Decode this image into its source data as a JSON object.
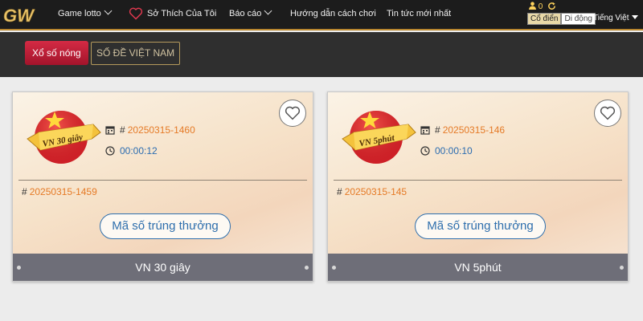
{
  "nav": {
    "logo_text": "GW",
    "items": [
      "Game lotto",
      "Sở Thích Của Tôi",
      "Báo cáo",
      "Hướng dẫn cách chơi",
      "Tin tức mới nhất"
    ],
    "balance": "0",
    "mode_classic": "Cổ điển",
    "mode_mobile": "Di động",
    "language": "Tiếng Việt"
  },
  "subnav": {
    "hot_label": "Xổ số nóng",
    "vn_label": "SỐ ĐỀ VIỆT NAM"
  },
  "cards": [
    {
      "emblem_text": "VN 30 giây",
      "current_draw": "20250315-1460",
      "countdown": "00:00:12",
      "last_draw": "20250315-1459",
      "win_button": "Mã số trúng thưởng",
      "footer": "VN 30 giây"
    },
    {
      "emblem_text": "VN 5phút",
      "current_draw": "20250315-146",
      "countdown": "00:00:10",
      "last_draw": "20250315-145",
      "win_button": "Mã số trúng thưởng",
      "footer": "VN 5phút"
    }
  ],
  "colors": {
    "accent_gold": "#b8862e",
    "hot_red": "#c21f38",
    "link_blue": "#2f6fad",
    "number_orange": "#e57a26"
  }
}
